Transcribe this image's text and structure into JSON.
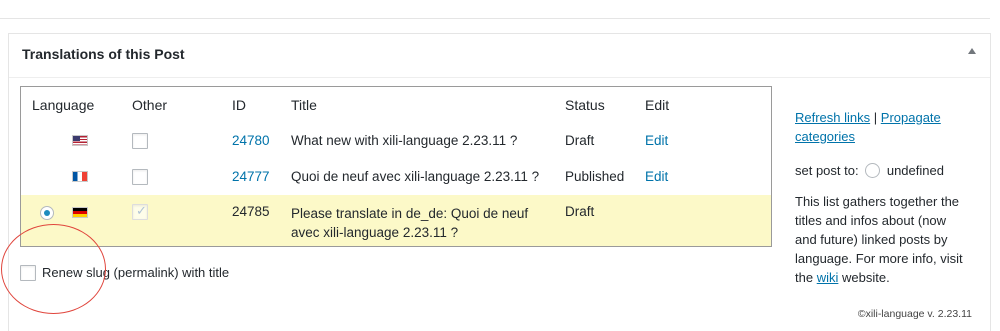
{
  "metabox": {
    "title": "Translations of this Post"
  },
  "table": {
    "headers": {
      "language": "Language",
      "other": "Other",
      "id": "ID",
      "title": "Title",
      "status": "Status",
      "edit": "Edit"
    },
    "rows": [
      {
        "flag": "us-flag-icon",
        "id": "24780",
        "title": "What new with xili-language 2.23.11 ?",
        "status": "Draft",
        "edit": "Edit",
        "current": false,
        "other_checked": false
      },
      {
        "flag": "fr-flag-icon",
        "id": "24777",
        "title": "Quoi de neuf avec xili-language 2.23.11 ?",
        "status": "Published",
        "edit": "Edit",
        "current": false,
        "other_checked": false
      },
      {
        "flag": "de-flag-icon",
        "id": "24785",
        "title_line1": "Please translate in de_de: Quoi de neuf",
        "title_line2": "avec xili-language 2.23.11 ?",
        "status": "Draft",
        "edit": "",
        "current": true,
        "other_checked": true
      }
    ]
  },
  "renew_slug": {
    "label": "Renew slug (permalink) with title",
    "checked": false
  },
  "sidebar": {
    "refresh_links": "Refresh links",
    "separator": "|",
    "propagate_line1": "Propagate",
    "propagate_line2": "categories",
    "set_post_to": "set post to:",
    "undefined": "undefined",
    "info_lines": [
      "This list gathers together the",
      "titles and infos about (now",
      "and future) linked posts by",
      "language. For more info, visit"
    ],
    "info_the": "the",
    "wiki": "wiki",
    "info_website": "website."
  },
  "footer": "©xili-language v. 2.23.11",
  "colors": {
    "link": "#0073aa",
    "highlight_row": "#fcf9c8",
    "annotation": "#e0453c"
  }
}
